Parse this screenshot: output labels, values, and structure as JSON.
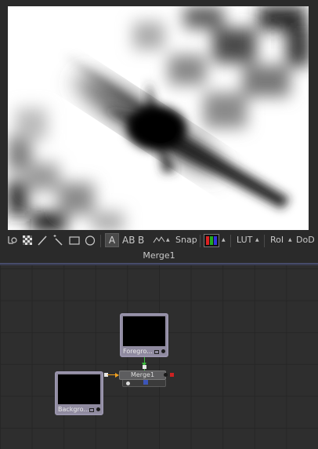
{
  "viewer": {
    "label": "Merge1"
  },
  "toolbar": {
    "tool_a": "A",
    "tool_ab": "AB",
    "tool_b": "B",
    "snap_label": "Snap",
    "lut_label": "LUT",
    "roi_label": "RoI",
    "dod_label": "DoD"
  },
  "flow": {
    "nodes": [
      {
        "id": "foreground",
        "label": "Foregro..."
      },
      {
        "id": "background",
        "label": "Backgro..."
      },
      {
        "id": "merge",
        "label": "Merge1"
      }
    ],
    "colors": {
      "foreground_wire": "#3dbb3d",
      "background_wire": "#f0a020",
      "mask_port": "#3c55b8",
      "output_port": "#cc2222"
    }
  }
}
